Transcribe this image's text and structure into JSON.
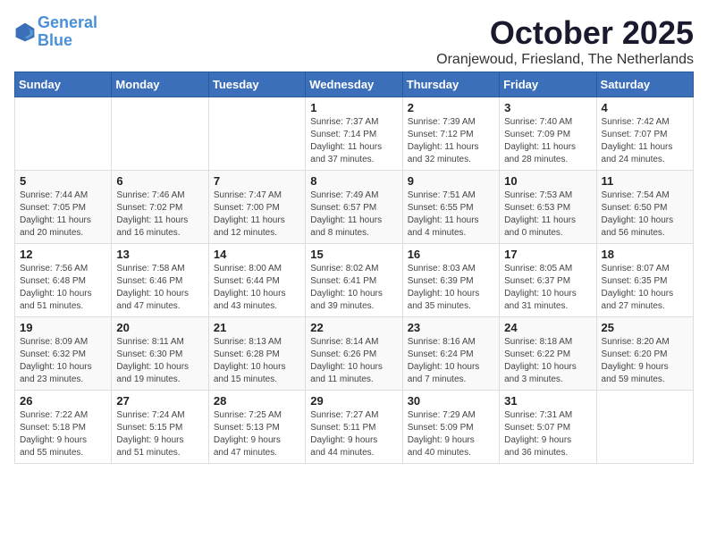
{
  "logo": {
    "line1": "General",
    "line2": "Blue"
  },
  "title": "October 2025",
  "location": "Oranjewoud, Friesland, The Netherlands",
  "weekdays": [
    "Sunday",
    "Monday",
    "Tuesday",
    "Wednesday",
    "Thursday",
    "Friday",
    "Saturday"
  ],
  "weeks": [
    [
      {
        "day": "",
        "info": ""
      },
      {
        "day": "",
        "info": ""
      },
      {
        "day": "",
        "info": ""
      },
      {
        "day": "1",
        "info": "Sunrise: 7:37 AM\nSunset: 7:14 PM\nDaylight: 11 hours\nand 37 minutes."
      },
      {
        "day": "2",
        "info": "Sunrise: 7:39 AM\nSunset: 7:12 PM\nDaylight: 11 hours\nand 32 minutes."
      },
      {
        "day": "3",
        "info": "Sunrise: 7:40 AM\nSunset: 7:09 PM\nDaylight: 11 hours\nand 28 minutes."
      },
      {
        "day": "4",
        "info": "Sunrise: 7:42 AM\nSunset: 7:07 PM\nDaylight: 11 hours\nand 24 minutes."
      }
    ],
    [
      {
        "day": "5",
        "info": "Sunrise: 7:44 AM\nSunset: 7:05 PM\nDaylight: 11 hours\nand 20 minutes."
      },
      {
        "day": "6",
        "info": "Sunrise: 7:46 AM\nSunset: 7:02 PM\nDaylight: 11 hours\nand 16 minutes."
      },
      {
        "day": "7",
        "info": "Sunrise: 7:47 AM\nSunset: 7:00 PM\nDaylight: 11 hours\nand 12 minutes."
      },
      {
        "day": "8",
        "info": "Sunrise: 7:49 AM\nSunset: 6:57 PM\nDaylight: 11 hours\nand 8 minutes."
      },
      {
        "day": "9",
        "info": "Sunrise: 7:51 AM\nSunset: 6:55 PM\nDaylight: 11 hours\nand 4 minutes."
      },
      {
        "day": "10",
        "info": "Sunrise: 7:53 AM\nSunset: 6:53 PM\nDaylight: 11 hours\nand 0 minutes."
      },
      {
        "day": "11",
        "info": "Sunrise: 7:54 AM\nSunset: 6:50 PM\nDaylight: 10 hours\nand 56 minutes."
      }
    ],
    [
      {
        "day": "12",
        "info": "Sunrise: 7:56 AM\nSunset: 6:48 PM\nDaylight: 10 hours\nand 51 minutes."
      },
      {
        "day": "13",
        "info": "Sunrise: 7:58 AM\nSunset: 6:46 PM\nDaylight: 10 hours\nand 47 minutes."
      },
      {
        "day": "14",
        "info": "Sunrise: 8:00 AM\nSunset: 6:44 PM\nDaylight: 10 hours\nand 43 minutes."
      },
      {
        "day": "15",
        "info": "Sunrise: 8:02 AM\nSunset: 6:41 PM\nDaylight: 10 hours\nand 39 minutes."
      },
      {
        "day": "16",
        "info": "Sunrise: 8:03 AM\nSunset: 6:39 PM\nDaylight: 10 hours\nand 35 minutes."
      },
      {
        "day": "17",
        "info": "Sunrise: 8:05 AM\nSunset: 6:37 PM\nDaylight: 10 hours\nand 31 minutes."
      },
      {
        "day": "18",
        "info": "Sunrise: 8:07 AM\nSunset: 6:35 PM\nDaylight: 10 hours\nand 27 minutes."
      }
    ],
    [
      {
        "day": "19",
        "info": "Sunrise: 8:09 AM\nSunset: 6:32 PM\nDaylight: 10 hours\nand 23 minutes."
      },
      {
        "day": "20",
        "info": "Sunrise: 8:11 AM\nSunset: 6:30 PM\nDaylight: 10 hours\nand 19 minutes."
      },
      {
        "day": "21",
        "info": "Sunrise: 8:13 AM\nSunset: 6:28 PM\nDaylight: 10 hours\nand 15 minutes."
      },
      {
        "day": "22",
        "info": "Sunrise: 8:14 AM\nSunset: 6:26 PM\nDaylight: 10 hours\nand 11 minutes."
      },
      {
        "day": "23",
        "info": "Sunrise: 8:16 AM\nSunset: 6:24 PM\nDaylight: 10 hours\nand 7 minutes."
      },
      {
        "day": "24",
        "info": "Sunrise: 8:18 AM\nSunset: 6:22 PM\nDaylight: 10 hours\nand 3 minutes."
      },
      {
        "day": "25",
        "info": "Sunrise: 8:20 AM\nSunset: 6:20 PM\nDaylight: 9 hours\nand 59 minutes."
      }
    ],
    [
      {
        "day": "26",
        "info": "Sunrise: 7:22 AM\nSunset: 5:18 PM\nDaylight: 9 hours\nand 55 minutes."
      },
      {
        "day": "27",
        "info": "Sunrise: 7:24 AM\nSunset: 5:15 PM\nDaylight: 9 hours\nand 51 minutes."
      },
      {
        "day": "28",
        "info": "Sunrise: 7:25 AM\nSunset: 5:13 PM\nDaylight: 9 hours\nand 47 minutes."
      },
      {
        "day": "29",
        "info": "Sunrise: 7:27 AM\nSunset: 5:11 PM\nDaylight: 9 hours\nand 44 minutes."
      },
      {
        "day": "30",
        "info": "Sunrise: 7:29 AM\nSunset: 5:09 PM\nDaylight: 9 hours\nand 40 minutes."
      },
      {
        "day": "31",
        "info": "Sunrise: 7:31 AM\nSunset: 5:07 PM\nDaylight: 9 hours\nand 36 minutes."
      },
      {
        "day": "",
        "info": ""
      }
    ]
  ]
}
